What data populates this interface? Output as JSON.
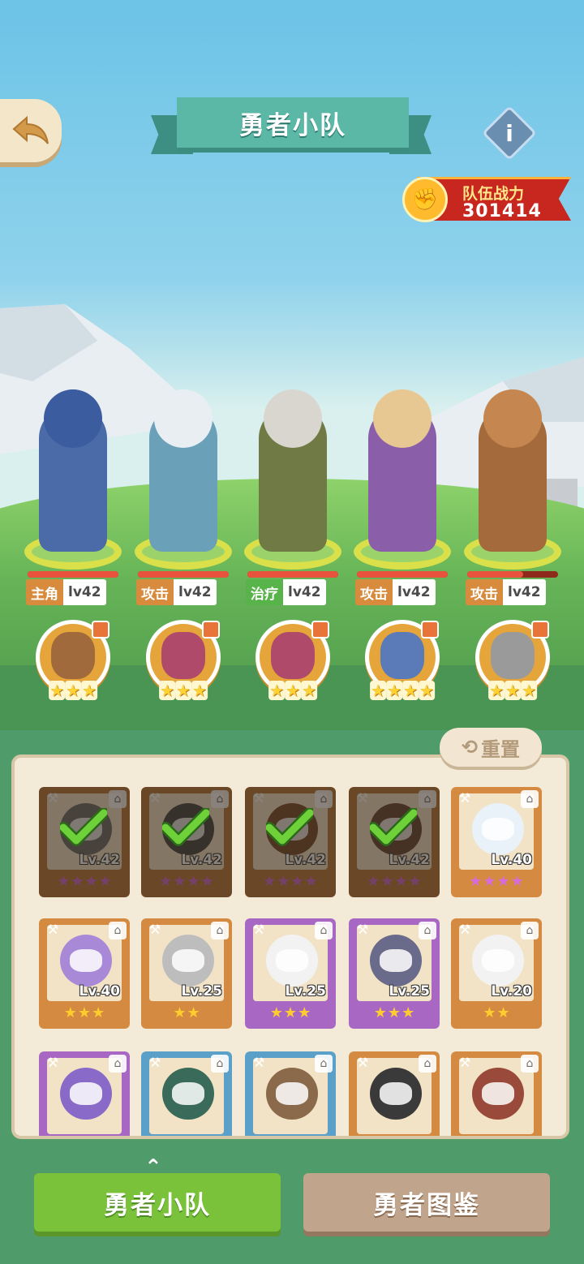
{
  "header": {
    "title": "勇者小队",
    "back_icon": "back-arrow-icon",
    "info_icon": "info-icon"
  },
  "team_power": {
    "label": "队伍战力",
    "value": "301414"
  },
  "heroes": [
    {
      "role": "主角",
      "level": "lv42",
      "role_color": "#d88b3c",
      "hp": 1.0,
      "body_color": "#4a6aa8",
      "head_color": "#3b5c9e"
    },
    {
      "role": "攻击",
      "level": "lv42",
      "role_color": "#d88b3c",
      "hp": 1.0,
      "body_color": "#6aa0b8",
      "head_color": "#e8eef2"
    },
    {
      "role": "治疗",
      "level": "lv42",
      "role_color": "#58b34a",
      "hp": 1.0,
      "body_color": "#6f7a45",
      "head_color": "#d9d6d0"
    },
    {
      "role": "攻击",
      "level": "lv42",
      "role_color": "#d88b3c",
      "hp": 1.0,
      "body_color": "#8a5ea8",
      "head_color": "#e8c892"
    },
    {
      "role": "攻击",
      "level": "lv42",
      "role_color": "#d88b3c",
      "hp": 0.62,
      "body_color": "#a56a3c",
      "head_color": "#c5874f"
    }
  ],
  "pets": [
    {
      "stars": 3,
      "art_color": "#a06a3c"
    },
    {
      "stars": 3,
      "art_color": "#b04a6a"
    },
    {
      "stars": 3,
      "art_color": "#b04a6a"
    },
    {
      "stars": 4,
      "art_color": "#5a7ab8"
    },
    {
      "stars": 3,
      "art_color": "#9a9a9a"
    }
  ],
  "reset_label": "重置",
  "roster": [
    {
      "level": "Lv.42",
      "stars": 4,
      "selected": true,
      "frame": "#b97a3e",
      "blob": "#6f6f6f"
    },
    {
      "level": "Lv.42",
      "stars": 4,
      "selected": true,
      "frame": "#b97a3e",
      "blob": "#4a4a4a"
    },
    {
      "level": "Lv.42",
      "stars": 4,
      "selected": true,
      "frame": "#b97a3e",
      "blob": "#7a5030"
    },
    {
      "level": "Lv.42",
      "stars": 4,
      "selected": true,
      "frame": "#b97a3e",
      "blob": "#6a4a3a"
    },
    {
      "level": "Lv.40",
      "stars": 4,
      "selected": false,
      "frame": "#d48a40",
      "blob": "#e8f2f8"
    },
    {
      "level": "Lv.40",
      "stars": 3,
      "selected": false,
      "frame": "#d48a40",
      "blob": "#a889d8"
    },
    {
      "level": "Lv.25",
      "stars": 2,
      "selected": false,
      "frame": "#d48a40",
      "blob": "#bdbdbd"
    },
    {
      "level": "Lv.25",
      "stars": 3,
      "selected": false,
      "frame": "#a867c2",
      "blob": "#f2f2f2"
    },
    {
      "level": "Lv.25",
      "stars": 3,
      "selected": false,
      "frame": "#a867c2",
      "blob": "#6a6a8a"
    },
    {
      "level": "Lv.20",
      "stars": 2,
      "selected": false,
      "frame": "#d48a40",
      "blob": "#f2f2f2"
    },
    {
      "level": "",
      "stars": 0,
      "selected": false,
      "frame": "#a867c2",
      "blob": "#8a6ac8"
    },
    {
      "level": "",
      "stars": 0,
      "selected": false,
      "frame": "#5aa0c8",
      "blob": "#3a6a5a"
    },
    {
      "level": "",
      "stars": 0,
      "selected": false,
      "frame": "#5aa0c8",
      "blob": "#8a6a4a"
    },
    {
      "level": "",
      "stars": 0,
      "selected": false,
      "frame": "#d48a40",
      "blob": "#3a3a3a"
    },
    {
      "level": "",
      "stars": 0,
      "selected": false,
      "frame": "#d48a40",
      "blob": "#9a4a3a"
    }
  ],
  "tabs": {
    "team": "勇者小队",
    "codex": "勇者图鉴"
  }
}
